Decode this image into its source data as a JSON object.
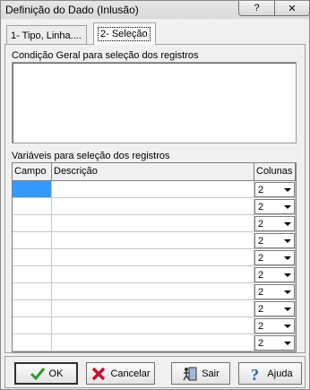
{
  "window": {
    "title": "Definição do Dado (Inlusão)",
    "help_glyph": "?",
    "close_glyph": "✕"
  },
  "tabs": [
    {
      "label": "1- Tipo, Linha....",
      "selected": false
    },
    {
      "label": "2- Seleção",
      "selected": true
    }
  ],
  "condition": {
    "label": "Condição Geral para seleção dos registros",
    "value": ""
  },
  "variables": {
    "label": "Variáveis para seleção dos registros",
    "columns": [
      "Campo",
      "Descrição",
      "Colunas"
    ],
    "rows": [
      {
        "campo": "",
        "descricao": "",
        "colunas": "2"
      },
      {
        "campo": "",
        "descricao": "",
        "colunas": "2"
      },
      {
        "campo": "",
        "descricao": "",
        "colunas": "2"
      },
      {
        "campo": "",
        "descricao": "",
        "colunas": "2"
      },
      {
        "campo": "",
        "descricao": "",
        "colunas": "2"
      },
      {
        "campo": "",
        "descricao": "",
        "colunas": "2"
      },
      {
        "campo": "",
        "descricao": "",
        "colunas": "2"
      },
      {
        "campo": "",
        "descricao": "",
        "colunas": "2"
      },
      {
        "campo": "",
        "descricao": "",
        "colunas": "2"
      },
      {
        "campo": "",
        "descricao": "",
        "colunas": "2"
      }
    ]
  },
  "buttons": {
    "ok": "OK",
    "cancel": "Cancelar",
    "exit": "Sair",
    "help": "Ajuda"
  },
  "colors": {
    "selection": "#3399ff",
    "ok_icon": "#2e9b2e",
    "cancel_icon": "#c8102e",
    "help_icon": "#1f5fbf"
  }
}
